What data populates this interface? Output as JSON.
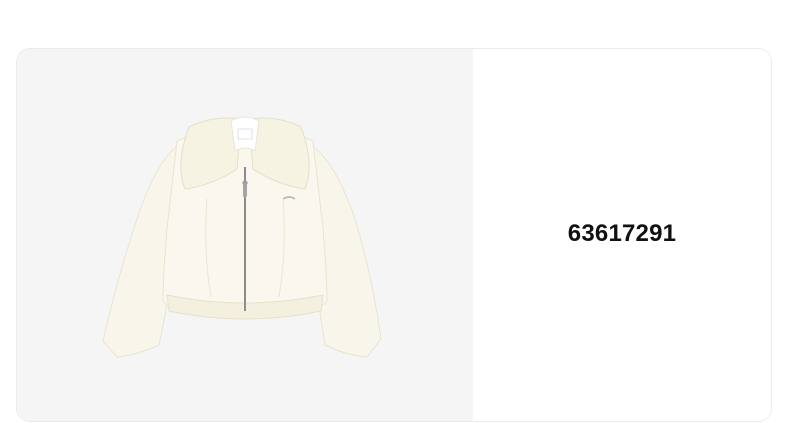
{
  "product": {
    "code": "63617291",
    "image_icon": "jacket-image"
  },
  "colors": {
    "image_background": "#f5f5f5",
    "jacket": "#f8f6ea",
    "text": "#111111"
  }
}
